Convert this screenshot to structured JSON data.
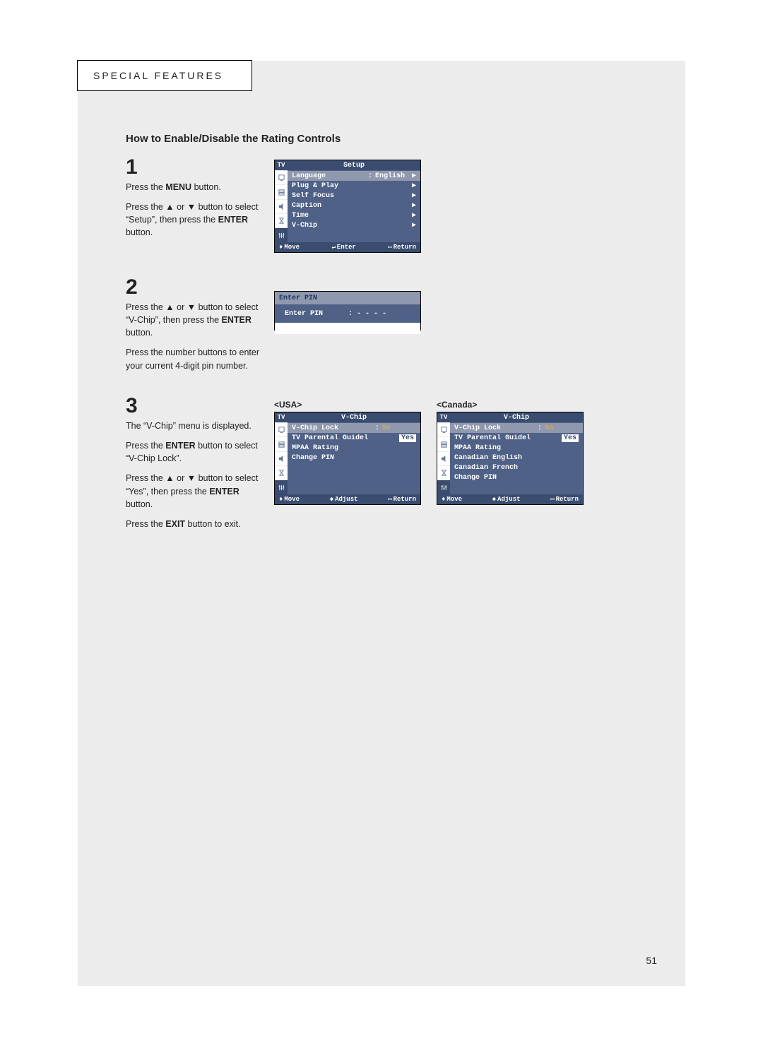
{
  "header_tab": "SPECIAL FEATURES",
  "page_title": "How to Enable/Disable the Rating Controls",
  "page_number": "51",
  "step1": {
    "num": "1",
    "line1a": "Press the ",
    "line1b": "MENU",
    "line1c": " button.",
    "line2a": "Press the ",
    "line2b": " or ",
    "line2c": " button to select “Setup”, then press the ",
    "line2d": "ENTER",
    "line2e": " button."
  },
  "step2": {
    "num": "2",
    "line1a": "Press the ",
    "line1b": " or ",
    "line1c": " button to select “V-Chip”, then press the ",
    "line1d": "ENTER",
    "line1e": " button.",
    "line2": "Press the number buttons to enter your current 4-digit pin number."
  },
  "step3": {
    "num": "3",
    "line1": "The “V-Chip” menu is displayed.",
    "line2a": "Press the ",
    "line2b": "ENTER",
    "line2c": " button to select “V-Chip Lock”.",
    "line3a": "Press the ",
    "line3b": " or ",
    "line3c": " button to select “Yes”, then press the ",
    "line3d": "ENTER",
    "line3e": " button.",
    "line4a": "Press the ",
    "line4b": "EXIT",
    "line4c": " button to exit."
  },
  "regions": {
    "usa": "<USA>",
    "canada": "<Canada>"
  },
  "osd_setup": {
    "tv": "TV",
    "title": "Setup",
    "rows": [
      {
        "label": "Language",
        "sep": ":",
        "val": "English",
        "caret": "▶",
        "sel": true
      },
      {
        "label": "Plug & Play",
        "caret": "▶"
      },
      {
        "label": "Self Focus",
        "caret": "▶"
      },
      {
        "label": "Caption",
        "caret": "▶"
      },
      {
        "label": "Time",
        "caret": "▶"
      },
      {
        "label": "V-Chip",
        "caret": "▶"
      }
    ],
    "footer": {
      "move": "Move",
      "enter": "Enter",
      "ret": "Return"
    }
  },
  "osd_pin": {
    "head": "Enter PIN",
    "label": "Enter PIN",
    "value": ": - - - -"
  },
  "osd_vchip_usa": {
    "tv": "TV",
    "title": "V-Chip",
    "rows": [
      {
        "label": "V-Chip Lock",
        "sep": ":",
        "valhl": "No",
        "sel": true
      },
      {
        "label": "TV Parental Guidel",
        "valinv": "Yes"
      },
      {
        "label": "MPAA Rating"
      },
      {
        "label": "Change PIN"
      }
    ],
    "footer": {
      "move": "Move",
      "adjust": "Adjust",
      "ret": "Return"
    }
  },
  "osd_vchip_can": {
    "tv": "TV",
    "title": "V-Chip",
    "rows": [
      {
        "label": "V-Chip Lock",
        "sep": ":",
        "valhl": "No",
        "sel": true
      },
      {
        "label": "TV Parental Guidel",
        "valinv": "Yes"
      },
      {
        "label": "MPAA Rating"
      },
      {
        "label": "Canadian English"
      },
      {
        "label": "Canadian French"
      },
      {
        "label": "Change PIN"
      }
    ],
    "footer": {
      "move": "Move",
      "adjust": "Adjust",
      "ret": "Return"
    }
  }
}
